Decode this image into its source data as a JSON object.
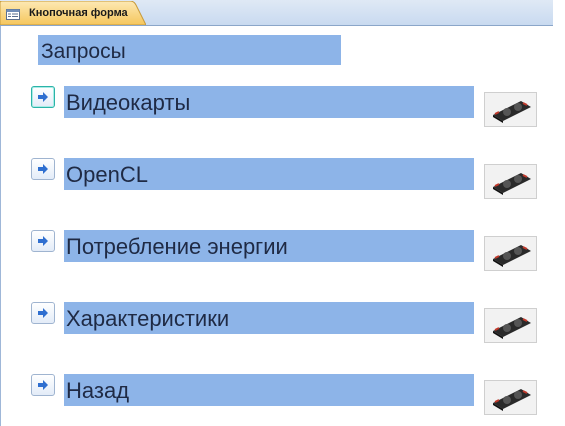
{
  "tab": {
    "title": "Кнопочная форма",
    "icon": "form-icon"
  },
  "form": {
    "title": "Запросы",
    "items": [
      {
        "label": "Видеокарты",
        "button_icon": "arrow-right-icon",
        "image": "graphics-card-image"
      },
      {
        "label": "OpenCL",
        "button_icon": "arrow-right-icon",
        "image": "graphics-card-image"
      },
      {
        "label": "Потребление энергии",
        "button_icon": "arrow-right-icon",
        "image": "graphics-card-image"
      },
      {
        "label": "Характеристики",
        "button_icon": "arrow-right-icon",
        "image": "graphics-card-image"
      },
      {
        "label": "Назад",
        "button_icon": "arrow-right-icon",
        "image": "graphics-card-image"
      }
    ]
  },
  "colors": {
    "label_background": "#8db4e8",
    "tab_active": "#f7d27a",
    "tab_strip": "#c9daf0"
  }
}
